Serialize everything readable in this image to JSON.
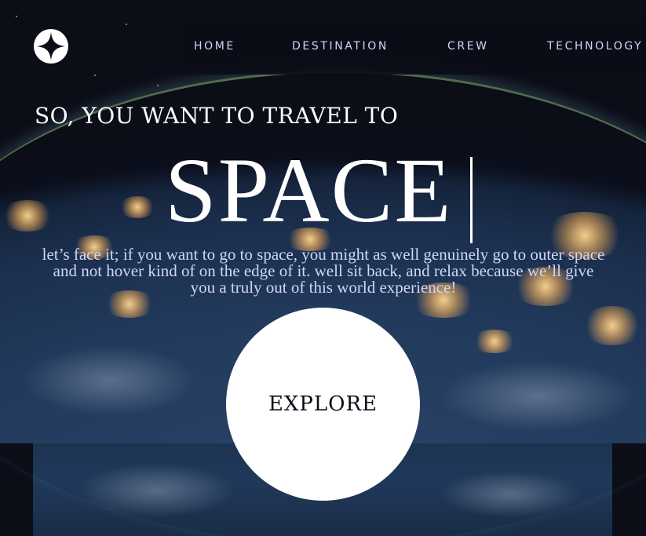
{
  "header": {
    "logo_icon": "star-logo-icon",
    "nav": [
      {
        "label": "HOME"
      },
      {
        "label": "DESTINATION"
      },
      {
        "label": "CREW"
      },
      {
        "label": "TECHNOLOGY"
      }
    ]
  },
  "hero": {
    "subheading": "SO, YOU WANT TO TRAVEL TO",
    "heading": "SPACE",
    "body": "let’s face it; if you want to go to space, you might as well genuinely go to outer space and not hover kind of on the edge of it. well sit back, and relax because we’ll give you a truly out of this world experience!",
    "explore_label": "EXPLORE"
  },
  "colors": {
    "background": "#0b0d17",
    "nav_text": "#d0d6f9",
    "button": "#ffffff"
  }
}
